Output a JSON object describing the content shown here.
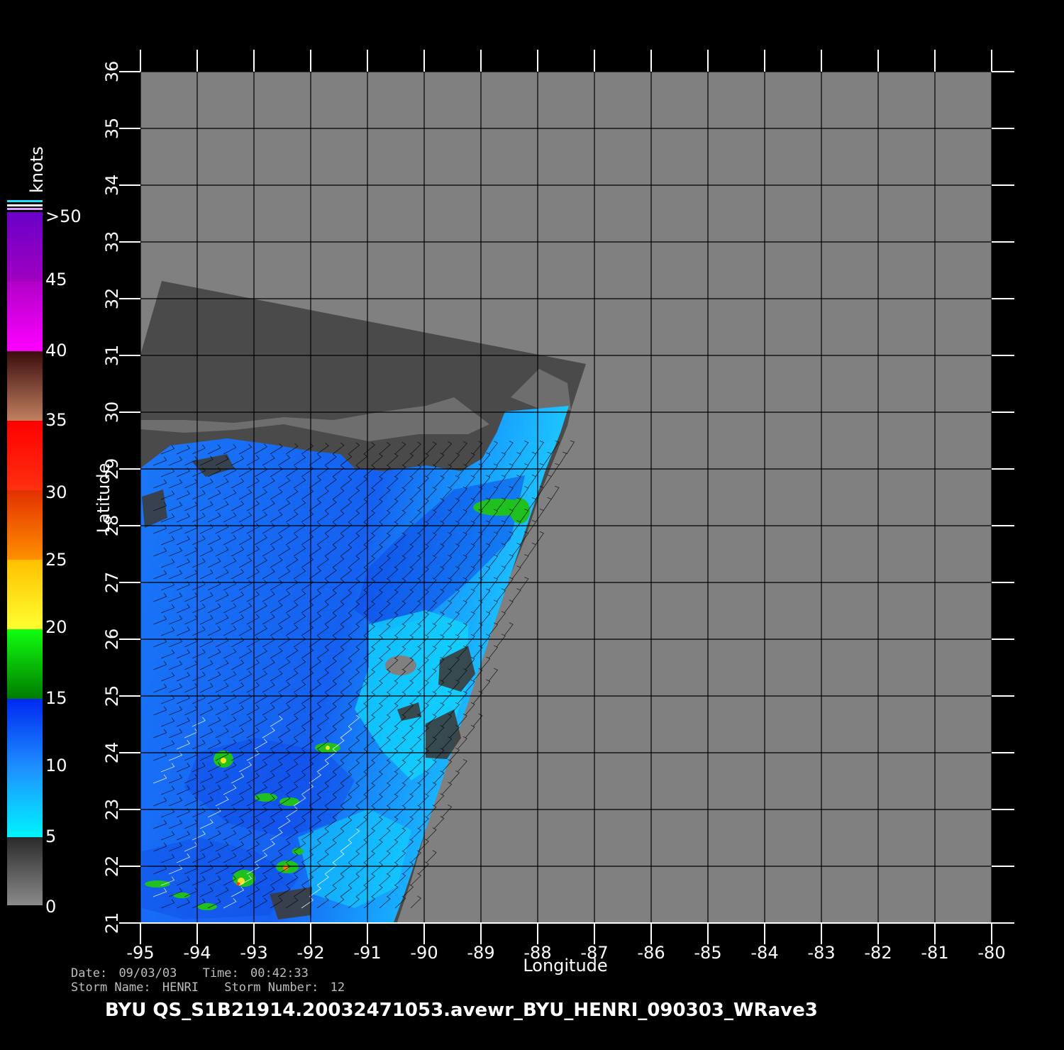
{
  "colorbar": {
    "units": "knots",
    "labels": [
      "0",
      "5",
      "10",
      "15",
      "20",
      "25",
      "30",
      "35",
      "40",
      "45",
      ">50"
    ]
  },
  "axes": {
    "xlabel": "Longitude",
    "ylabel": "Latitude",
    "lon_ticks": [
      "-95",
      "-94",
      "-93",
      "-92",
      "-91",
      "-90",
      "-89",
      "-88",
      "-87",
      "-86",
      "-85",
      "-84",
      "-83",
      "-82",
      "-81",
      "-80"
    ],
    "lat_ticks": [
      "21",
      "22",
      "23",
      "24",
      "25",
      "26",
      "27",
      "28",
      "29",
      "30",
      "31",
      "32",
      "33",
      "34",
      "35",
      "36"
    ]
  },
  "info": {
    "date_label": "Date:",
    "date": "09/03/03",
    "time_label": "Time:",
    "time": "00:42:33",
    "storm_name_label": "Storm  Name:",
    "storm_name": "HENRI",
    "storm_number_label": "Storm  Number:",
    "storm_number": "12"
  },
  "filename": "BYU  QS_S1B21914.20032471053.avewr_BYU_HENRI_090303_WRave3",
  "colors": {
    "background": "#000000",
    "no_data": "#808080",
    "land": "#4a4a4a",
    "low_wind": "#00e5ff",
    "mid_wind": "#1e73ff",
    "high_wind": "#0050f0",
    "green": "#20c020"
  }
}
